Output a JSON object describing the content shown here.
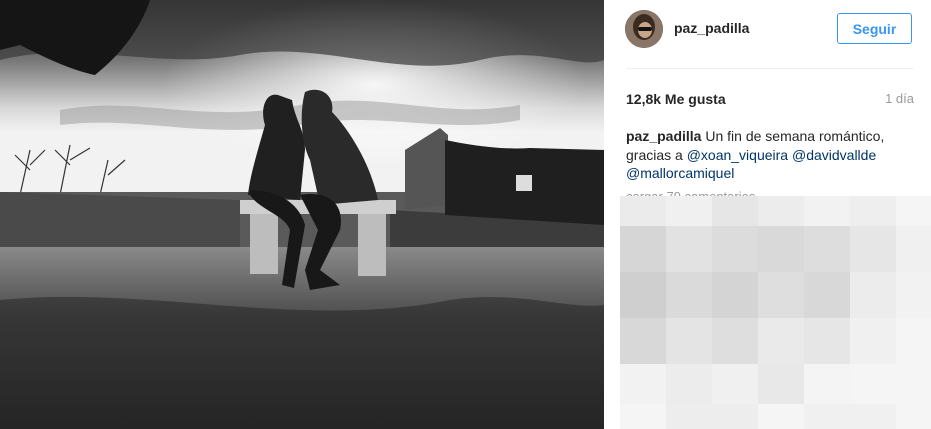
{
  "post": {
    "photo_alt": "",
    "author": "paz_padilla",
    "follow_label": "Seguir",
    "likes": "12,8k Me gusta",
    "time_ago": "1 día",
    "caption": {
      "user": "paz_padilla",
      "text_1": "Un fin de semana romántico, gracias a",
      "mention_1": "@xoan_viqueira",
      "mention_2": "@davidvallde",
      "mention_3": "@mallorcamiquel"
    },
    "more_comments": "cargar 79 comentarios"
  },
  "colors": {
    "accent": "#3897f0",
    "text": "#262626",
    "muted": "#999999",
    "mention": "#003569"
  }
}
